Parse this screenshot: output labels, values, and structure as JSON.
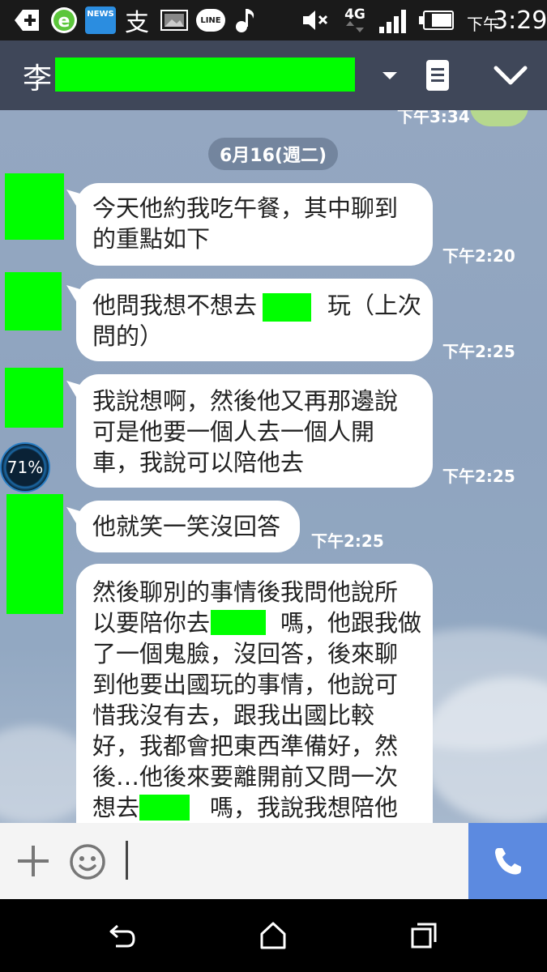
{
  "status_bar": {
    "news_label": "NEWS",
    "zhi_char": "支",
    "line_label": "LINE",
    "network": "4G",
    "time_prefix": "下午",
    "time": "3:29"
  },
  "header": {
    "contact_name": "李"
  },
  "chat": {
    "partial_time": "下午3:34",
    "date_separator": "6月16(週二)",
    "battery_widget": "71%",
    "messages": [
      {
        "lines": [
          "今天他約我吃午餐，其中聊到",
          "的重點如下"
        ],
        "time": "下午2:20"
      },
      {
        "lines": [
          "他問我想不想去　　　玩（上次",
          "問的）"
        ],
        "time": "下午2:25"
      },
      {
        "lines": [
          "我說想啊，然後他又再那邊說",
          "可是他要一個人去一個人開",
          "車，我說可以陪他去"
        ],
        "time": "下午2:25"
      },
      {
        "lines": [
          "他就笑一笑沒回答"
        ],
        "time": "下午2:25"
      },
      {
        "lines": [
          "然後聊別的事情後我問他說所",
          "以要陪你去　　　嗎，他跟我做",
          "了一個鬼臉，沒回答，後來聊",
          "到他要出國玩的事情，他說可",
          "惜我沒有去，跟我出國比較",
          "好，我都會把東西準備好，然",
          "後…他後來要離開前又問一次",
          "想去　　　嗎，我說我想陪他"
        ]
      }
    ]
  },
  "colors": {
    "header_bg": "#3f4759",
    "redaction": "#00ff00",
    "call_button": "#5c8ae0",
    "chat_bg": "#94a7c1"
  },
  "icons": {
    "add": "plus-icon",
    "emoji": "smiley-icon",
    "call": "phone-icon",
    "dropdown": "caret-down-icon",
    "notes": "notes-icon",
    "collapse": "chevron-down-icon"
  }
}
